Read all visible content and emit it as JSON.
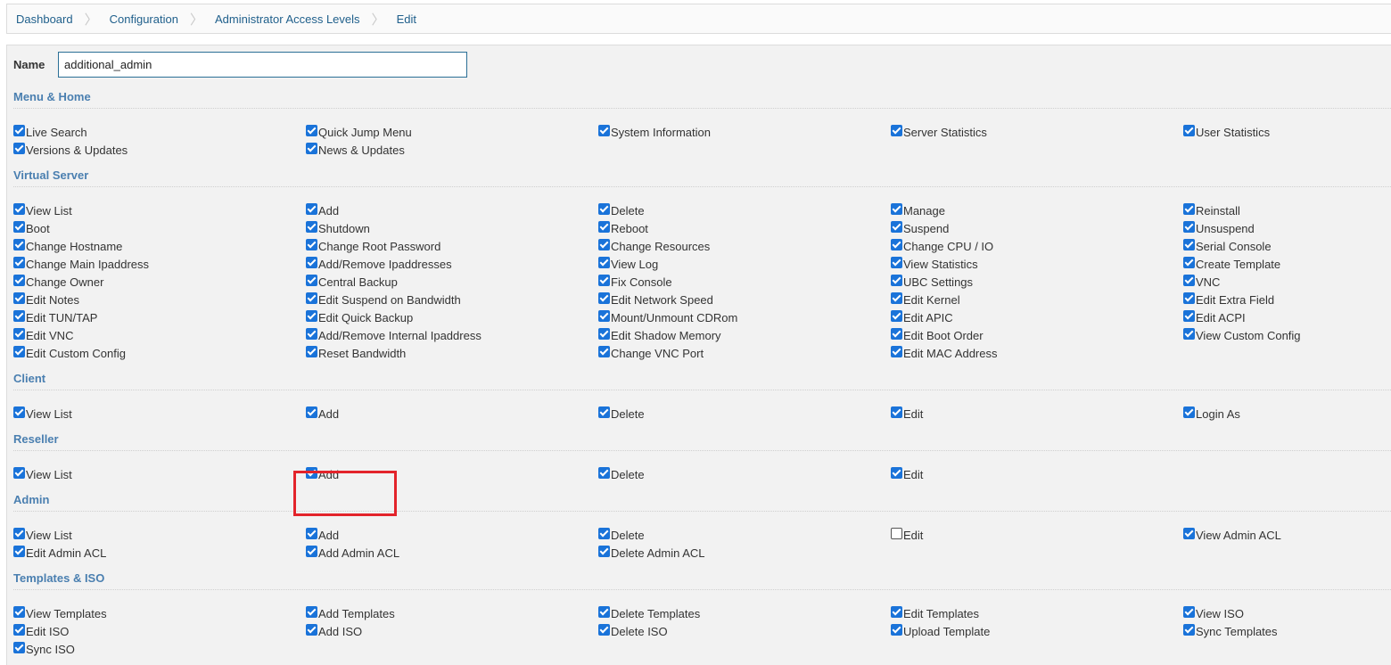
{
  "breadcrumb": [
    "Dashboard",
    "Configuration",
    "Administrator Access Levels",
    "Edit"
  ],
  "form": {
    "name_label": "Name",
    "name_value": "additional_admin"
  },
  "sections": [
    {
      "title": "Menu & Home",
      "rows": [
        [
          {
            "label": "Live Search",
            "checked": true
          },
          {
            "label": "Quick Jump Menu",
            "checked": true
          },
          {
            "label": "System Information",
            "checked": true
          },
          {
            "label": "Server Statistics",
            "checked": true
          },
          {
            "label": "User Statistics",
            "checked": true
          }
        ],
        [
          {
            "label": "Versions & Updates",
            "checked": true
          },
          {
            "label": "News & Updates",
            "checked": true
          }
        ]
      ]
    },
    {
      "title": "Virtual Server",
      "rows": [
        [
          {
            "label": "View List",
            "checked": true
          },
          {
            "label": "Add",
            "checked": true
          },
          {
            "label": "Delete",
            "checked": true
          },
          {
            "label": "Manage",
            "checked": true
          },
          {
            "label": "Reinstall",
            "checked": true
          }
        ],
        [
          {
            "label": "Boot",
            "checked": true
          },
          {
            "label": "Shutdown",
            "checked": true
          },
          {
            "label": "Reboot",
            "checked": true
          },
          {
            "label": "Suspend",
            "checked": true
          },
          {
            "label": "Unsuspend",
            "checked": true
          }
        ],
        [
          {
            "label": "Change Hostname",
            "checked": true
          },
          {
            "label": "Change Root Password",
            "checked": true
          },
          {
            "label": "Change Resources",
            "checked": true
          },
          {
            "label": "Change CPU / IO",
            "checked": true
          },
          {
            "label": "Serial Console",
            "checked": true
          }
        ],
        [
          {
            "label": "Change Main Ipaddress",
            "checked": true
          },
          {
            "label": "Add/Remove Ipaddresses",
            "checked": true
          },
          {
            "label": "View Log",
            "checked": true
          },
          {
            "label": "View Statistics",
            "checked": true
          },
          {
            "label": "Create Template",
            "checked": true
          }
        ],
        [
          {
            "label": "Change Owner",
            "checked": true
          },
          {
            "label": "Central Backup",
            "checked": true
          },
          {
            "label": "Fix Console",
            "checked": true
          },
          {
            "label": "UBC Settings",
            "checked": true
          },
          {
            "label": "VNC",
            "checked": true
          }
        ],
        [
          {
            "label": "Edit Notes",
            "checked": true
          },
          {
            "label": "Edit Suspend on Bandwidth",
            "checked": true
          },
          {
            "label": "Edit Network Speed",
            "checked": true
          },
          {
            "label": "Edit Kernel",
            "checked": true
          },
          {
            "label": "Edit Extra Field",
            "checked": true
          }
        ],
        [
          {
            "label": "Edit TUN/TAP",
            "checked": true
          },
          {
            "label": "Edit Quick Backup",
            "checked": true
          },
          {
            "label": "Mount/Unmount CDRom",
            "checked": true
          },
          {
            "label": "Edit APIC",
            "checked": true
          },
          {
            "label": "Edit ACPI",
            "checked": true
          }
        ],
        [
          {
            "label": "Edit VNC",
            "checked": true
          },
          {
            "label": "Add/Remove Internal Ipaddress",
            "checked": true
          },
          {
            "label": "Edit Shadow Memory",
            "checked": true
          },
          {
            "label": "Edit Boot Order",
            "checked": true
          },
          {
            "label": "View Custom Config",
            "checked": true
          }
        ],
        [
          {
            "label": "Edit Custom Config",
            "checked": true
          },
          {
            "label": "Reset Bandwidth",
            "checked": true
          },
          {
            "label": "Change VNC Port",
            "checked": true
          },
          {
            "label": "Edit MAC Address",
            "checked": true
          }
        ]
      ]
    },
    {
      "title": "Client",
      "rows": [
        [
          {
            "label": "View List",
            "checked": true
          },
          {
            "label": "Add",
            "checked": true
          },
          {
            "label": "Delete",
            "checked": true
          },
          {
            "label": "Edit",
            "checked": true
          },
          {
            "label": "Login As",
            "checked": true
          }
        ]
      ]
    },
    {
      "title": "Reseller",
      "rows": [
        [
          {
            "label": "View List",
            "checked": true
          },
          {
            "label": "Add",
            "checked": true
          },
          {
            "label": "Delete",
            "checked": true
          },
          {
            "label": "Edit",
            "checked": true
          }
        ]
      ]
    },
    {
      "title": "Admin",
      "rows": [
        [
          {
            "label": "View List",
            "checked": true
          },
          {
            "label": "Add",
            "checked": true
          },
          {
            "label": "Delete",
            "checked": true
          },
          {
            "label": "Edit",
            "checked": false
          },
          {
            "label": "View Admin ACL",
            "checked": true
          }
        ],
        [
          {
            "label": "Edit Admin ACL",
            "checked": true
          },
          {
            "label": "Add Admin ACL",
            "checked": true
          },
          {
            "label": "Delete Admin ACL",
            "checked": true
          }
        ]
      ]
    },
    {
      "title": "Templates & ISO",
      "rows": [
        [
          {
            "label": "View Templates",
            "checked": true
          },
          {
            "label": "Add Templates",
            "checked": true
          },
          {
            "label": "Delete Templates",
            "checked": true
          },
          {
            "label": "Edit Templates",
            "checked": true
          },
          {
            "label": "View ISO",
            "checked": true
          }
        ],
        [
          {
            "label": "Edit ISO",
            "checked": true
          },
          {
            "label": "Add ISO",
            "checked": true
          },
          {
            "label": "Delete ISO",
            "checked": true
          },
          {
            "label": "Upload Template",
            "checked": true
          },
          {
            "label": "Sync Templates",
            "checked": true
          }
        ],
        [
          {
            "label": "Sync ISO",
            "checked": true
          }
        ]
      ]
    }
  ],
  "colors": {
    "link": "#1f5f8b",
    "section_title": "#4a7fb0",
    "checkbox": "#1a73d9",
    "highlight": "#e3242b"
  }
}
